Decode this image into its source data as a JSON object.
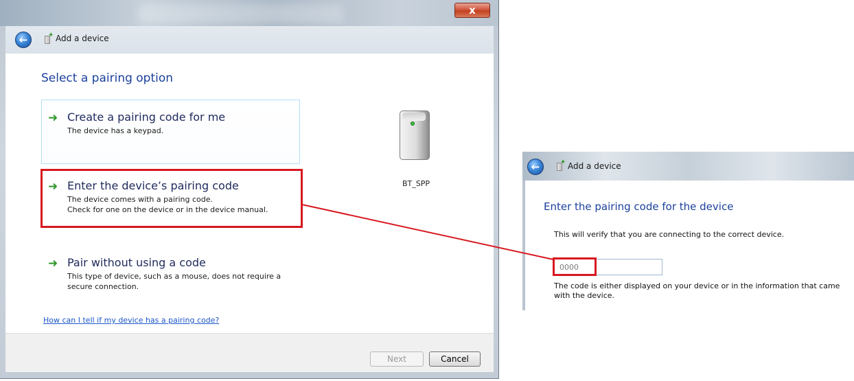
{
  "left_dialog": {
    "close_label": "x",
    "header_title": "Add a device",
    "heading": "Select a pairing option",
    "options": [
      {
        "title": "Create a pairing code for me",
        "desc_lines": [
          "The device has a keypad."
        ]
      },
      {
        "title": "Enter the device’s pairing code",
        "desc_lines": [
          "The device comes with a pairing code.",
          "Check for one on the device or in the device manual."
        ]
      },
      {
        "title": "Pair without using a code",
        "desc_lines": [
          "This type of device, such as a mouse, does not require a",
          "secure connection."
        ]
      }
    ],
    "device_name": "BT_SPP",
    "help_link": "How can I tell if my device has a pairing code?",
    "buttons": {
      "next": "Next",
      "cancel": "Cancel"
    }
  },
  "right_dialog": {
    "header_title": "Add a device",
    "heading": "Enter the pairing code for the device",
    "info": "This will verify that you are connecting to the correct device.",
    "code_value": "0000",
    "note": "The code is either displayed on your device or in the information that came with the device."
  },
  "colors": {
    "highlight": "#d7171f",
    "heading": "#1a3f9c",
    "link": "#1a55c8"
  },
  "icons": {
    "back": "back-arrow-icon",
    "option_arrow": "green-arrow-icon",
    "device": "device-tower-icon"
  }
}
